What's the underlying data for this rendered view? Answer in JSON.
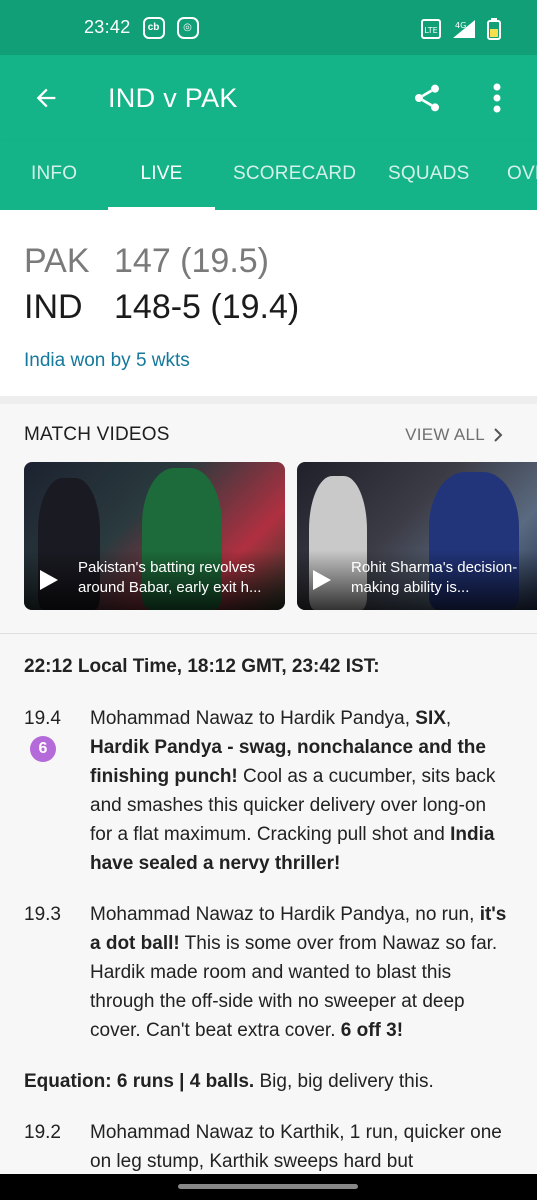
{
  "status_bar": {
    "time": "23:42",
    "icons": [
      "cb-icon",
      "instagram-icon"
    ],
    "network": "4G"
  },
  "app_bar": {
    "title": "IND v PAK"
  },
  "tabs": [
    {
      "label": "INFO",
      "active": false
    },
    {
      "label": "LIVE",
      "active": true
    },
    {
      "label": "SCORECARD",
      "active": false
    },
    {
      "label": "SQUADS",
      "active": false
    },
    {
      "label": "OVERS",
      "active": false
    }
  ],
  "score": {
    "team1": {
      "name": "PAK",
      "score": "147 (19.5)"
    },
    "team2": {
      "name": "IND",
      "score": "148-5 (19.4)"
    },
    "result": "India won by 5 wkts"
  },
  "videos": {
    "header": "MATCH VIDEOS",
    "view_all": "VIEW ALL",
    "items": [
      {
        "title": "Pakistan's batting revolves around Babar, early exit h..."
      },
      {
        "title": "Rohit Sharma's decision-making ability is..."
      }
    ]
  },
  "commentary": {
    "time_header": "22:12 Local Time, 18:12 GMT, 23:42 IST:",
    "balls": [
      {
        "over": "19.4",
        "badge": "6",
        "parts": [
          {
            "t": "Mohammad Nawaz to Hardik Pandya, ",
            "b": false
          },
          {
            "t": "SIX",
            "b": true
          },
          {
            "t": ", ",
            "b": false
          },
          {
            "t": "Hardik Pandya - swag, nonchalance and the finishing punch!",
            "b": true
          },
          {
            "t": " Cool as a cucumber, sits back and smashes this quicker delivery over long-on for a flat maximum. Cracking pull shot and ",
            "b": false
          },
          {
            "t": "India have sealed a nervy thriller!",
            "b": true
          }
        ]
      },
      {
        "over": "19.3",
        "badge": "",
        "parts": [
          {
            "t": "Mohammad Nawaz to Hardik Pandya, no run, ",
            "b": false
          },
          {
            "t": "it's a dot ball!",
            "b": true
          },
          {
            "t": " This is some over from Nawaz so far. Hardik made room and wanted to blast this through the off-side with no sweeper at deep cover. Can't beat extra cover. ",
            "b": false
          },
          {
            "t": "6 off 3!",
            "b": true
          }
        ]
      }
    ],
    "equation": [
      {
        "t": "Equation: 6 runs | 4 balls.",
        "b": true
      },
      {
        "t": " Big, big delivery this.",
        "b": false
      }
    ],
    "last_ball": {
      "over": "19.2",
      "parts": [
        {
          "t": "Mohammad Nawaz to Karthik, 1 run, quicker one on leg stump, Karthik sweeps hard but",
          "b": false
        }
      ]
    }
  },
  "colors": {
    "primary": "#14b388",
    "status": "#119f78",
    "link": "#14799c",
    "six_badge": "#b56ad9"
  }
}
